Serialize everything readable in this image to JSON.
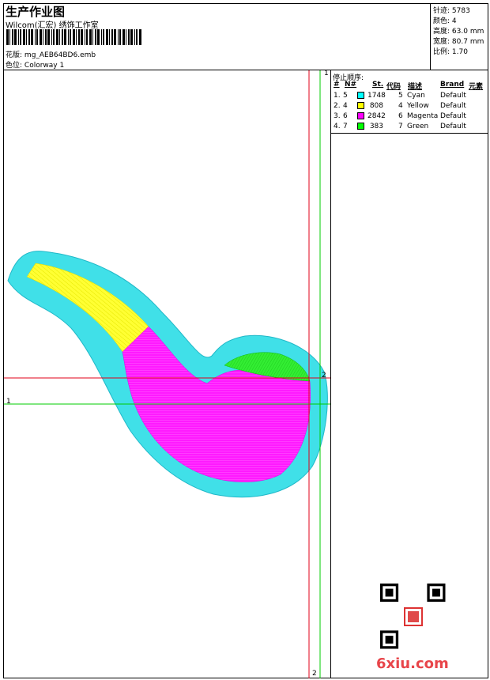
{
  "header": {
    "title": "生产作业图",
    "subtitle": "Wilcom(汇宏) 绣饰工作室",
    "design_label": "花版:",
    "design_file": "mg_AEB64BD6.emb",
    "colorway_label": "色位:",
    "colorway": "Colorway 1"
  },
  "stats": [
    {
      "label": "针迹:",
      "value": "5783"
    },
    {
      "label": "颜色:",
      "value": "4"
    },
    {
      "label": "高度:",
      "value": "63.0 mm"
    },
    {
      "label": "宽度:",
      "value": "80.7 mm"
    },
    {
      "label": "比例:",
      "value": "1.70"
    }
  ],
  "stop_sequence": {
    "title": "停止顺序:",
    "columns": [
      "#",
      "N#",
      "St.",
      "代码",
      "描述",
      "Brand",
      "元素"
    ],
    "rows": [
      {
        "num": "1.",
        "n": "5",
        "color": "#00ffff",
        "stitches": "1748",
        "code": "5",
        "desc": "Cyan",
        "brand": "Default"
      },
      {
        "num": "2.",
        "n": "4",
        "color": "#ffff00",
        "stitches": "808",
        "code": "4",
        "desc": "Yellow",
        "brand": "Default"
      },
      {
        "num": "3.",
        "n": "6",
        "color": "#ff00ff",
        "stitches": "2842",
        "code": "6",
        "desc": "Magenta",
        "brand": "Default"
      },
      {
        "num": "4.",
        "n": "7",
        "color": "#00ff00",
        "stitches": "383",
        "code": "7",
        "desc": "Green",
        "brand": "Default"
      }
    ]
  },
  "guides": {
    "h_red_label": "2",
    "h_green_label": "1",
    "v_red_label": "2",
    "v_green_label": "1"
  },
  "colors": {
    "cyan": "#40e0e8",
    "yellow": "#ffff33",
    "magenta": "#ff1aff",
    "green": "#33ee33",
    "guide_red": "#e0001a",
    "guide_green": "#00cc00"
  },
  "watermark": "6xiu.com"
}
